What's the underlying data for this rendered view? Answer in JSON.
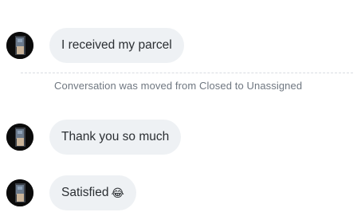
{
  "messages": [
    {
      "text": "I received my parcel"
    },
    {
      "text": "Thank you so much"
    },
    {
      "text": "Satisfied",
      "emoji": "😂"
    }
  ],
  "system_note": {
    "text": "Conversation was moved from Closed to Unassigned"
  },
  "icons": {
    "avatar": "user-avatar",
    "emoji": "laughing-emoji"
  },
  "colors": {
    "bubble_bg": "#eef1f4",
    "bubble_text": "#2b2f33",
    "system_text": "#6f7780",
    "divider": "#d9dde2"
  }
}
